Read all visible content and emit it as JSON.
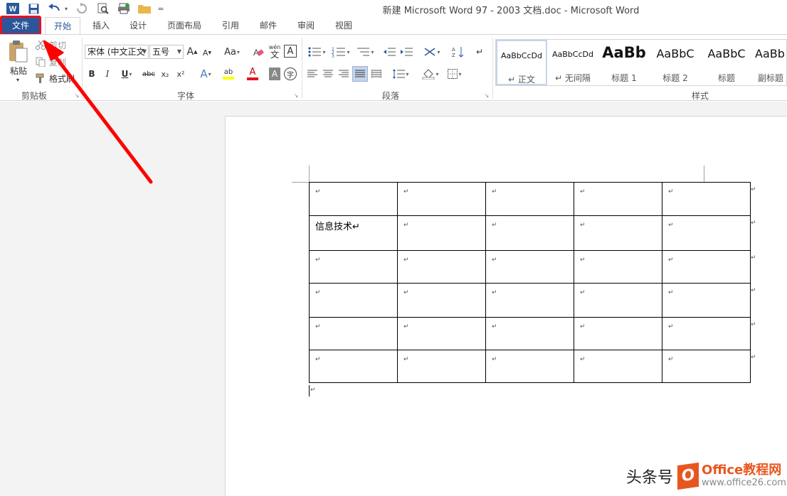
{
  "window": {
    "title": "新建 Microsoft Word 97 - 2003 文档.doc - Microsoft Word"
  },
  "quick_access": {
    "customize_glyph": "="
  },
  "tabs": [
    {
      "label": "文件"
    },
    {
      "label": "开始"
    },
    {
      "label": "插入"
    },
    {
      "label": "设计"
    },
    {
      "label": "页面布局"
    },
    {
      "label": "引用"
    },
    {
      "label": "邮件"
    },
    {
      "label": "审阅"
    },
    {
      "label": "视图"
    }
  ],
  "clipboard": {
    "paste": "粘贴",
    "cut": "剪切",
    "copy": "复制",
    "format_painter": "格式刷",
    "group": "剪贴板"
  },
  "font": {
    "name": "宋体 (中文正文",
    "size": "五号",
    "group": "字体",
    "grow": "A",
    "shrink": "A",
    "case": "Aa",
    "phonetic_top": "wén",
    "phonetic_bottom": "文",
    "border_char": "A",
    "bold": "B",
    "italic": "I",
    "underline": "U",
    "strike": "abc",
    "subscript": "x₂",
    "superscript": "x²",
    "effects": "A",
    "highlight": "ab",
    "color": "A",
    "shading": "A",
    "enclose": "字"
  },
  "paragraph": {
    "group": "段落"
  },
  "styles": {
    "group": "样式",
    "items": [
      {
        "sample": "AaBbCcDd",
        "name": "↵ 正文"
      },
      {
        "sample": "AaBbCcDd",
        "name": "↵ 无间隔"
      },
      {
        "sample": "AaBb",
        "name": "标题 1"
      },
      {
        "sample": "AaBbC",
        "name": "标题 2"
      },
      {
        "sample": "AaBbC",
        "name": "标题"
      },
      {
        "sample": "AaBb",
        "name": "副标题"
      }
    ]
  },
  "document": {
    "paragraph_mark": "↵",
    "table": [
      [
        "↵",
        "↵",
        "↵",
        "↵",
        "↵"
      ],
      [
        "信息技术↵",
        "↵",
        "↵",
        "↵",
        "↵"
      ],
      [
        "↵",
        "↵",
        "↵",
        "↵",
        "↵"
      ],
      [
        "↵",
        "↵",
        "↵",
        "↵",
        "↵"
      ],
      [
        "↵",
        "↵",
        "↵",
        "↵",
        "↵"
      ],
      [
        "↵",
        "↵",
        "↵",
        "↵",
        "↵"
      ]
    ]
  },
  "watermark": {
    "text": "头条号",
    "logo_letter": "O",
    "brand": "Office教程网",
    "url": "www.office26.com"
  },
  "colors": {
    "accent": "#2b579a",
    "highlight_box": "#e81123"
  }
}
